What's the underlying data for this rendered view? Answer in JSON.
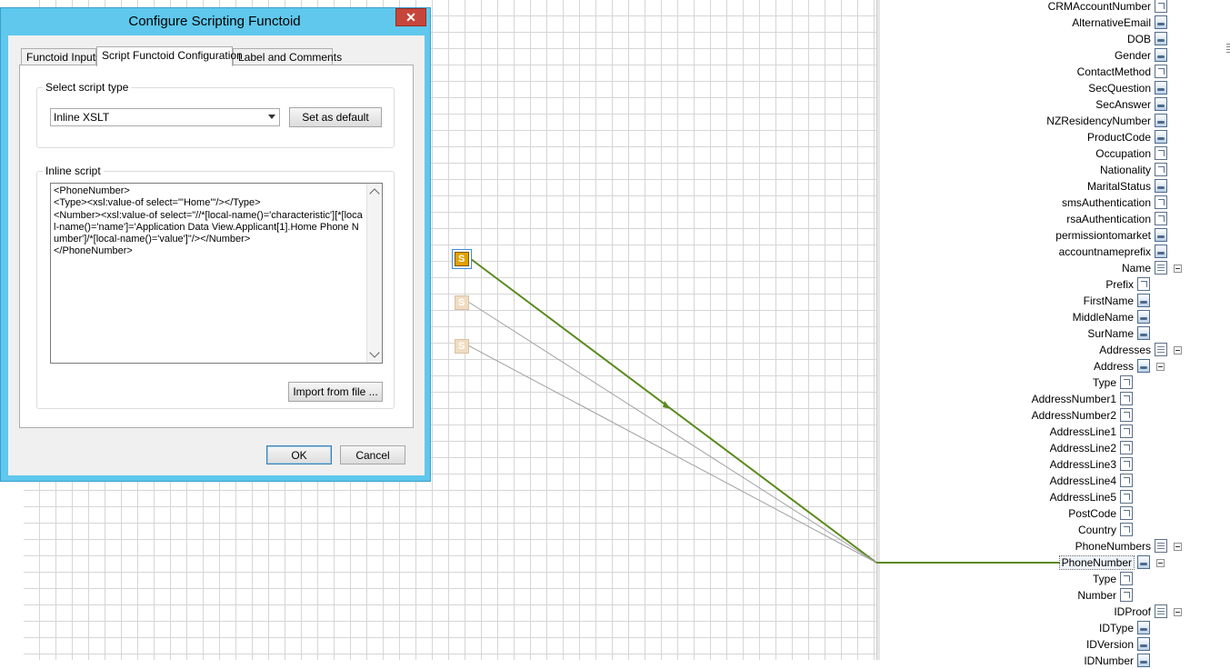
{
  "dialog": {
    "title": "Configure Scripting Functoid",
    "close": "✕",
    "tabs": [
      {
        "label": "Functoid Inputs",
        "active": false
      },
      {
        "label": "Script Functoid Configuration",
        "active": true
      },
      {
        "label": "Label and Comments",
        "active": false
      }
    ],
    "script_type_group": "Select script type",
    "script_type_value": "Inline XSLT",
    "set_default_label": "Set as default",
    "inline_script_group": "Inline script",
    "script": "<PhoneNumber>\n<Type><xsl:value-of select=\"'Home'\"/></Type>\n<Number><xsl:value-of select=\"//*[local-name()='characteristic'][*[local-name()='name']='Application Data View.Applicant[1].Home Phone Number']/*[local-name()='value']\"/></Number>\n</PhoneNumber>",
    "import_label": "Import from file ...",
    "ok_label": "OK",
    "cancel_label": "Cancel"
  },
  "functoids": [
    {
      "label": "S",
      "state": "selected"
    },
    {
      "label": "S",
      "state": "faded"
    },
    {
      "label": "S",
      "state": "faded"
    }
  ],
  "schema": {
    "nodes": [
      {
        "label": "CRMAccountNumber",
        "icon": "field"
      },
      {
        "label": "AlternativeEmail",
        "icon": "linked"
      },
      {
        "label": "DOB",
        "icon": "linked"
      },
      {
        "label": "Gender",
        "icon": "linked"
      },
      {
        "label": "ContactMethod",
        "icon": "field"
      },
      {
        "label": "SecQuestion",
        "icon": "linked"
      },
      {
        "label": "SecAnswer",
        "icon": "linked"
      },
      {
        "label": "NZResidencyNumber",
        "icon": "linked"
      },
      {
        "label": "ProductCode",
        "icon": "linked"
      },
      {
        "label": "Occupation",
        "icon": "field"
      },
      {
        "label": "Nationality",
        "icon": "field"
      },
      {
        "label": "MaritalStatus",
        "icon": "linked"
      },
      {
        "label": "smsAuthentication",
        "icon": "field"
      },
      {
        "label": "rsaAuthentication",
        "icon": "field"
      },
      {
        "label": "permissiontomarket",
        "icon": "linked"
      },
      {
        "label": "accountnameprefix",
        "icon": "linked"
      },
      {
        "label": "Name",
        "icon": "record",
        "expander": true
      },
      {
        "label": "Prefix",
        "icon": "field"
      },
      {
        "label": "FirstName",
        "icon": "linked"
      },
      {
        "label": "MiddleName",
        "icon": "linked"
      },
      {
        "label": "SurName",
        "icon": "linked"
      },
      {
        "label": "Addresses",
        "icon": "record",
        "expander": true
      },
      {
        "label": "Address",
        "icon": "linked",
        "expander": true
      },
      {
        "label": "Type",
        "icon": "field"
      },
      {
        "label": "AddressNumber1",
        "icon": "field"
      },
      {
        "label": "AddressNumber2",
        "icon": "field"
      },
      {
        "label": "AddressLine1",
        "icon": "field"
      },
      {
        "label": "AddressLine2",
        "icon": "field"
      },
      {
        "label": "AddressLine3",
        "icon": "field"
      },
      {
        "label": "AddressLine4",
        "icon": "field"
      },
      {
        "label": "AddressLine5",
        "icon": "field"
      },
      {
        "label": "PostCode",
        "icon": "field"
      },
      {
        "label": "Country",
        "icon": "field"
      },
      {
        "label": "PhoneNumbers",
        "icon": "record",
        "expander": true
      },
      {
        "label": "PhoneNumber",
        "icon": "linked",
        "expander": true,
        "selected": true
      },
      {
        "label": "Type",
        "icon": "field"
      },
      {
        "label": "Number",
        "icon": "field"
      },
      {
        "label": "IDProof",
        "icon": "record",
        "expander": true
      },
      {
        "label": "IDType",
        "icon": "linked"
      },
      {
        "label": "IDVersion",
        "icon": "linked"
      },
      {
        "label": "IDNumber",
        "icon": "linked"
      }
    ]
  },
  "colors": {
    "title_bar": "#5fc8ec",
    "link_active": "#5a8a1e",
    "link_inactive": "#9a9a9a",
    "functoid": "#e3a100"
  }
}
